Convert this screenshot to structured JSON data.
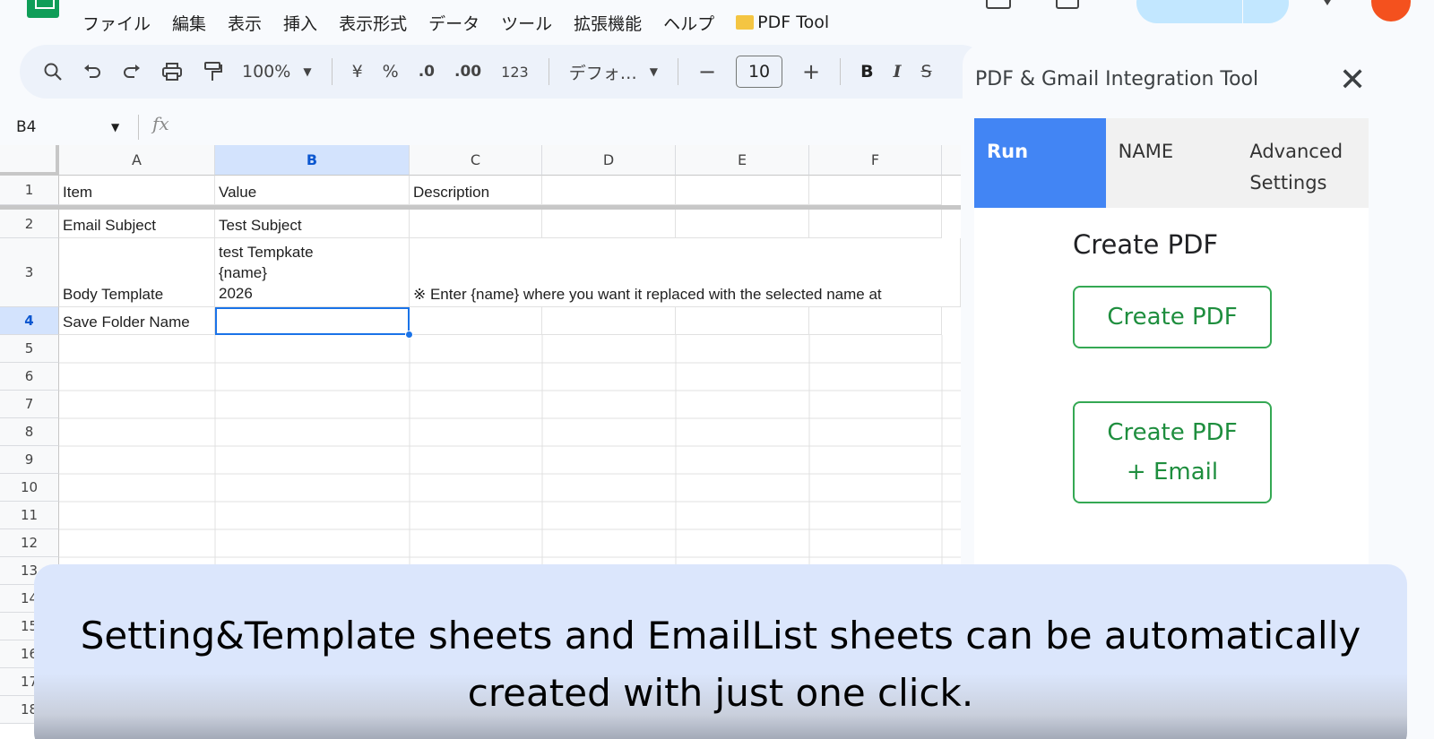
{
  "menu": [
    "ファイル",
    "編集",
    "表示",
    "挿入",
    "表示形式",
    "データ",
    "ツール",
    "拡張機能",
    "ヘルプ"
  ],
  "menu_extra": "PDF Tool",
  "toolbar": {
    "zoom": "100%",
    "currency": "¥",
    "percent": "%",
    "dec_less": ".0",
    "dec_more": ".00",
    "format_num": "123",
    "font": "デフォ…",
    "font_size": "10",
    "bold": "B",
    "italic": "I"
  },
  "formula_bar": {
    "name_box": "B4",
    "fx": "fx"
  },
  "sheet": {
    "columns": [
      "A",
      "B",
      "C",
      "D",
      "E",
      "F"
    ],
    "rows": [
      "1",
      "2",
      "3",
      "4",
      "5",
      "6",
      "7",
      "8",
      "9",
      "10",
      "11",
      "12",
      "13",
      "14",
      "15",
      "16",
      "17",
      "18"
    ],
    "cells": {
      "A1": "Item",
      "B1": "Value",
      "C1": "Description",
      "A2": "Email Subject",
      "B2": "Test Subject",
      "A3": "Body Template",
      "B3_line1": "test Tempkate",
      "B3_line2": "{name}",
      "B3_line3": "2026",
      "C3": "※ Enter {name} where you want it replaced with the selected name at",
      "A4": "Save Folder Name"
    }
  },
  "sidebar": {
    "title": "PDF & Gmail Integration Tool",
    "tabs": [
      "Run",
      "NAME",
      "Advanced Settings"
    ],
    "heading": "Create PDF",
    "button_create": "Create PDF",
    "button_create_email_line1": "Create PDF",
    "button_create_email_line2": "+ Email"
  },
  "caption": {
    "line1": "Setting&Template sheets and EmailList sheets can be automatically",
    "line2": "created with just one click."
  }
}
